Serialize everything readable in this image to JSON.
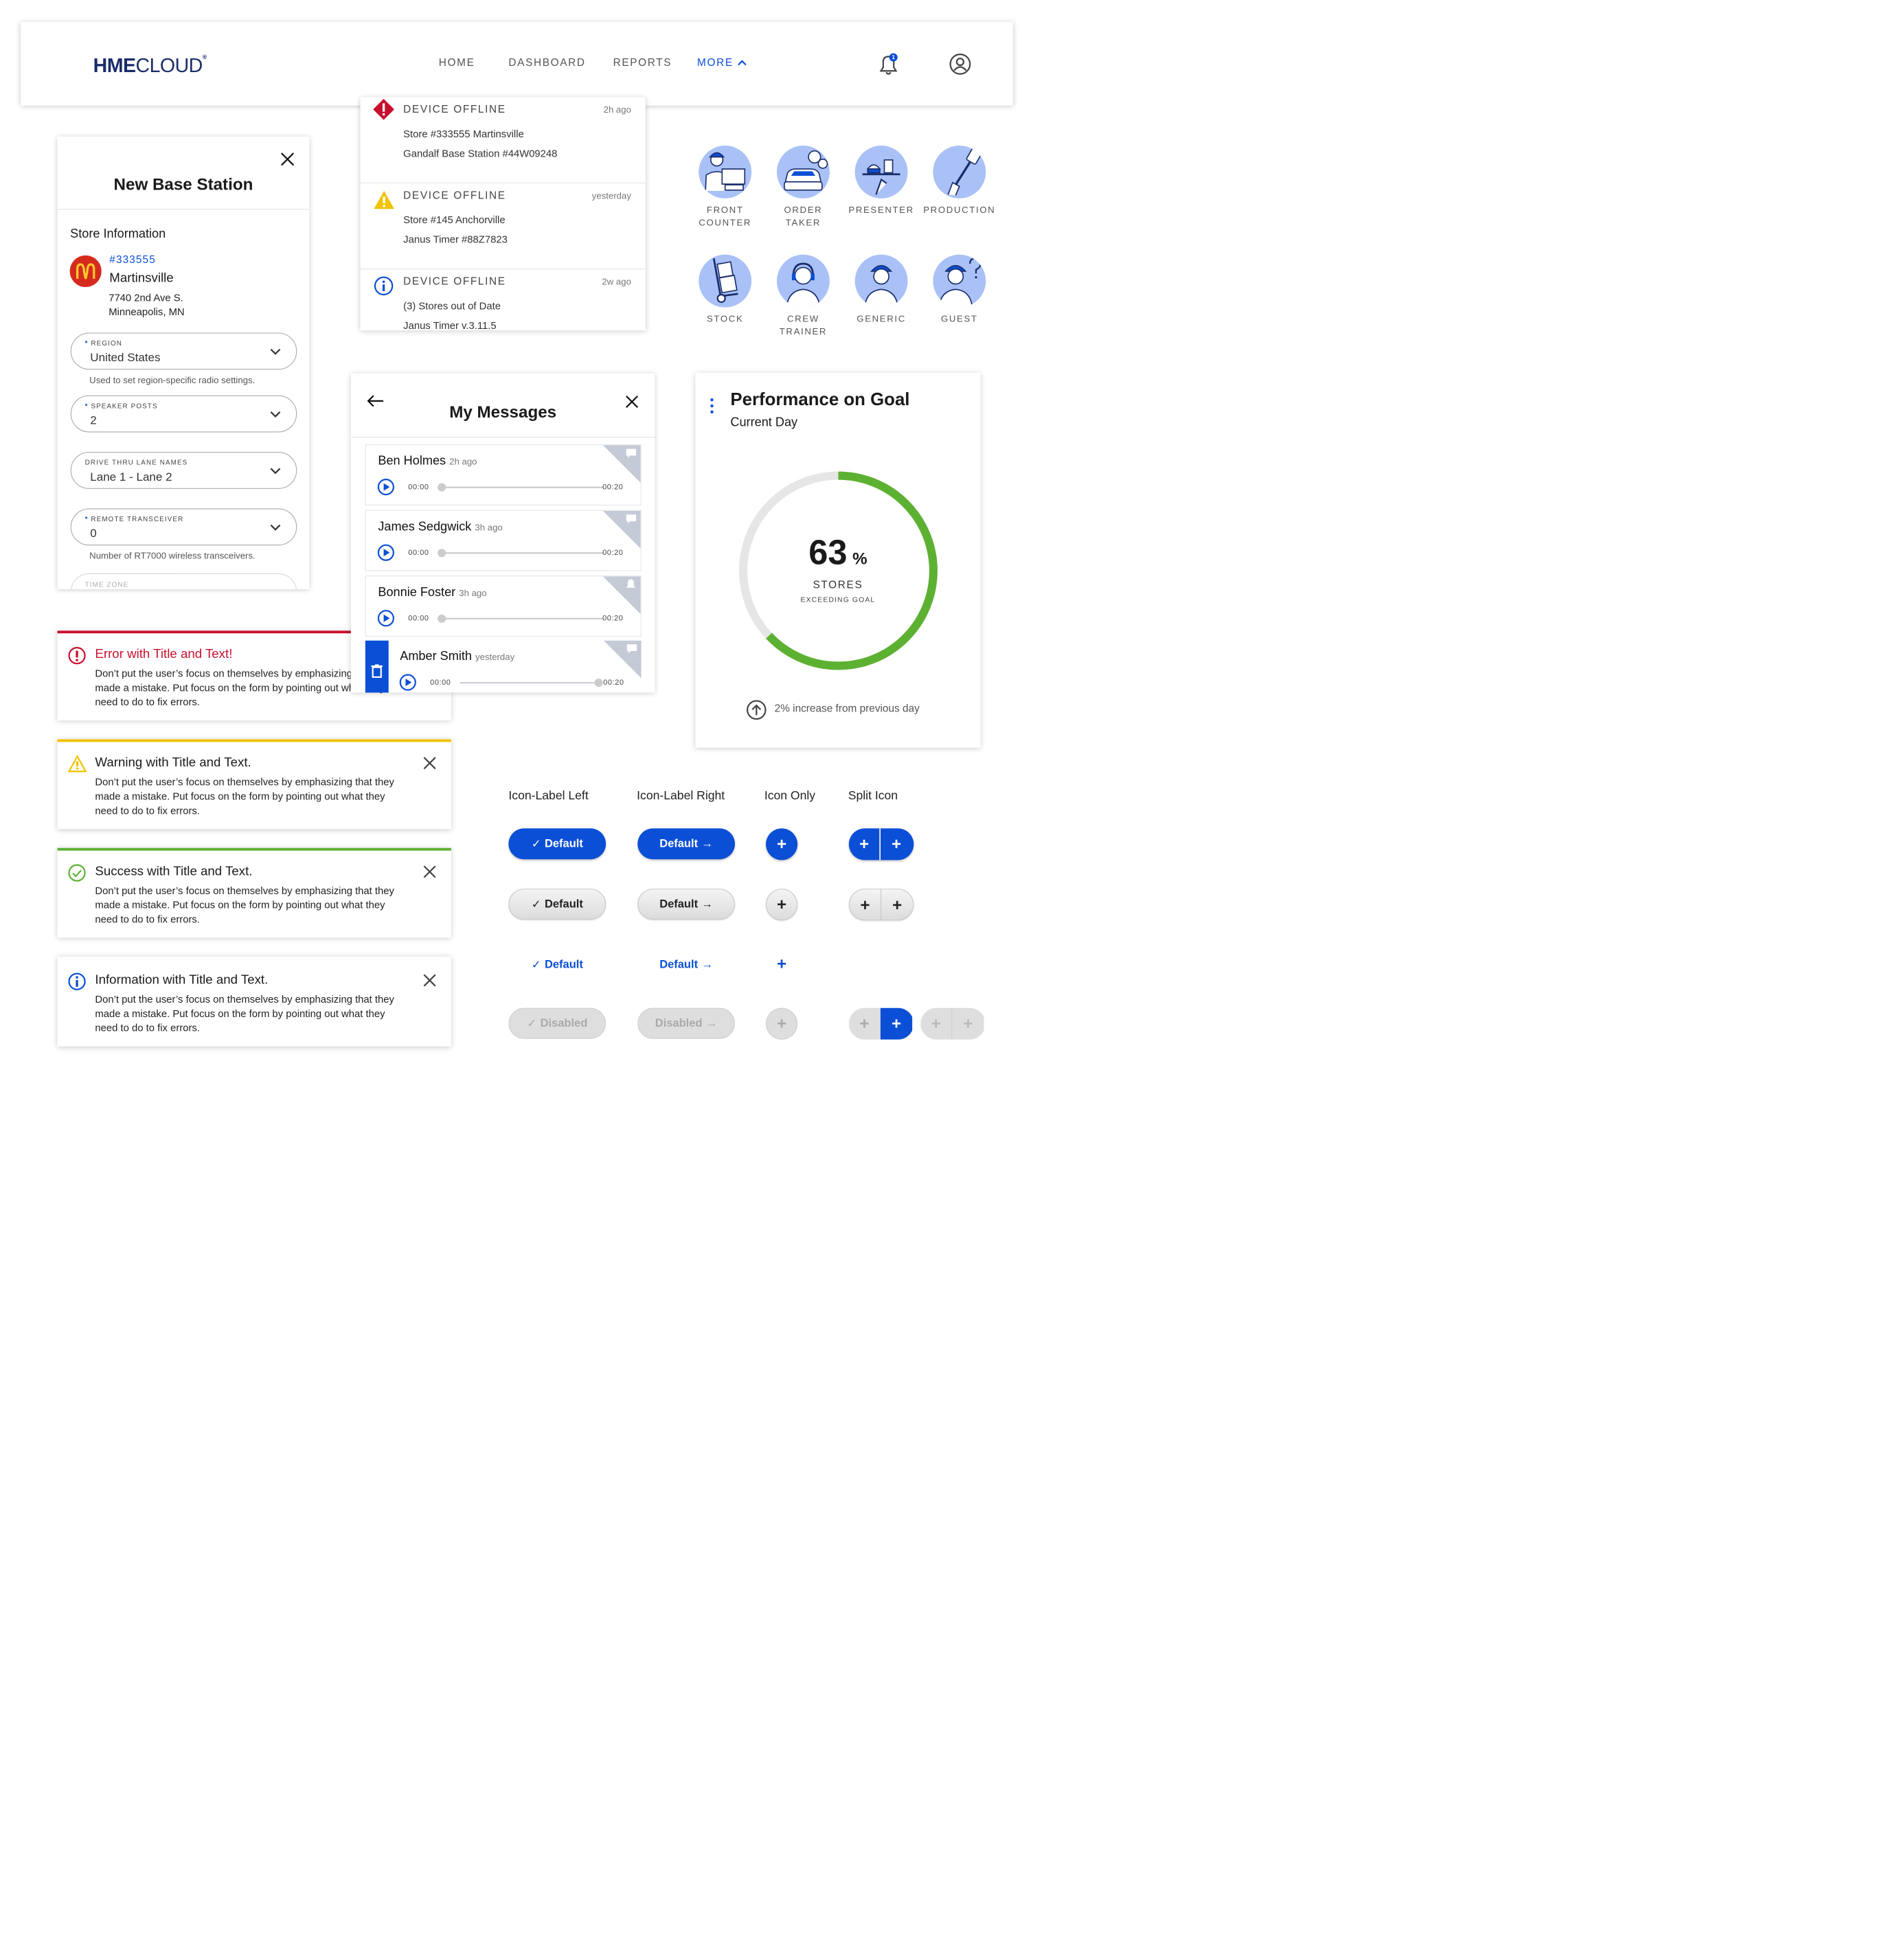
{
  "header": {
    "logo_hme": "HME",
    "logo_cloud": "CLOUD",
    "logo_mark": "®",
    "nav": [
      "HOME",
      "DASHBOARD",
      "REPORTS",
      "MORE"
    ],
    "notification_count": "1"
  },
  "notifications": [
    {
      "title": "DEVICE OFFLINE",
      "time": "2h ago",
      "line1": "Store #333555 Martinsville",
      "line2": "Gandalf Base Station #44W09248",
      "level": "error"
    },
    {
      "title": "DEVICE OFFLINE",
      "time": "yesterday",
      "line1": "Store #145 Anchorville",
      "line2": "Janus Timer #88Z7823",
      "level": "warning"
    },
    {
      "title": "DEVICE OFFLINE",
      "time": "2w ago",
      "line1": "(3) Stores out of Date",
      "line2": "Janus Timer v.3.11.5",
      "level": "info"
    }
  ],
  "base_station": {
    "title": "New Base Station",
    "section": "Store Information",
    "store_number": "#333555",
    "store_name": "Martinsville",
    "address1": "7740 2nd Ave S.",
    "address2": "Minneapolis, MN",
    "fields": [
      {
        "label": "REGION",
        "required": "*",
        "value": "United States",
        "hint": "Used to set region-specific radio settings."
      },
      {
        "label": "SPEAKER POSTS",
        "required": "*",
        "value": "2",
        "hint": ""
      },
      {
        "label": "DRIVE THRU LANE NAMES",
        "required": "",
        "value": "Lane 1 - Lane 2",
        "hint": ""
      },
      {
        "label": "REMOTE TRANSCEIVER",
        "required": "*",
        "value": "0",
        "hint": "Number of RT7000 wireless transceivers."
      },
      {
        "label": "TIME ZONE",
        "required": "",
        "value": "",
        "hint": ""
      }
    ]
  },
  "staff_roles": [
    [
      "FRONT",
      "COUNTER"
    ],
    [
      "ORDER",
      "TAKER"
    ],
    [
      "PRESENTER"
    ],
    [
      "PRODUCTION"
    ],
    [
      "STOCK"
    ],
    [
      "CREW",
      "TRAINER"
    ],
    [
      "GENERIC"
    ],
    [
      "GUEST"
    ]
  ],
  "messages": {
    "title": "My Messages",
    "items": [
      {
        "name": "Ben Holmes",
        "time": "2h ago",
        "start": "00:00",
        "end": "00:20",
        "progress": 0
      },
      {
        "name": "James Sedgwick",
        "time": "3h ago",
        "start": "00:00",
        "end": "00:20",
        "progress": 0
      },
      {
        "name": "Bonnie Foster",
        "time": "3h ago",
        "start": "00:00",
        "end": "00:20",
        "progress": 0
      },
      {
        "name": "Amber Smith",
        "time": "yesterday",
        "start": "00:00",
        "end": "00:20",
        "progress": 1
      }
    ]
  },
  "performance": {
    "title": "Performance on Goal",
    "subtitle": "Current Day",
    "value": "63",
    "unit": "%",
    "label1": "STORES",
    "label2": "EXCEEDING GOAL",
    "footer": "2% increase from previous day",
    "progress": 0.63,
    "color": "#5db132"
  },
  "alerts": [
    {
      "level": "error",
      "title": "Error with Title and Text!",
      "body": "Don’t put the user’s focus on themselves by emphasizing that they made a mistake. Put focus on the form by pointing out what they need to do to fix errors.",
      "color": "#c8102e"
    },
    {
      "level": "warning",
      "title": "Warning with Title and Text.",
      "body": "Don’t put the user’s focus on themselves by emphasizing that they made a mistake. Put focus on the form by pointing out what they need to do to fix errors.",
      "color": "#f2c200"
    },
    {
      "level": "success",
      "title": "Success with Title and Text.",
      "body": "Don’t put the user’s focus on themselves by emphasizing that they made a mistake. Put focus on the form by pointing out what they need to do to fix errors.",
      "color": "#5db132"
    },
    {
      "level": "info",
      "title": "Information with Title and Text.",
      "body": "Don’t put the user’s focus on themselves by emphasizing that they made a mistake. Put focus on the form by pointing out what they need to do to fix errors.",
      "color": "#0b4fd6"
    }
  ],
  "buttons": {
    "columns": [
      "Icon-Label Left",
      "Icon-Label Right",
      "Icon Only",
      "Split Icon"
    ],
    "default_label": "Default",
    "disabled_label": "Disabled",
    "plus": "+",
    "check": "✓",
    "arrow": "→"
  }
}
